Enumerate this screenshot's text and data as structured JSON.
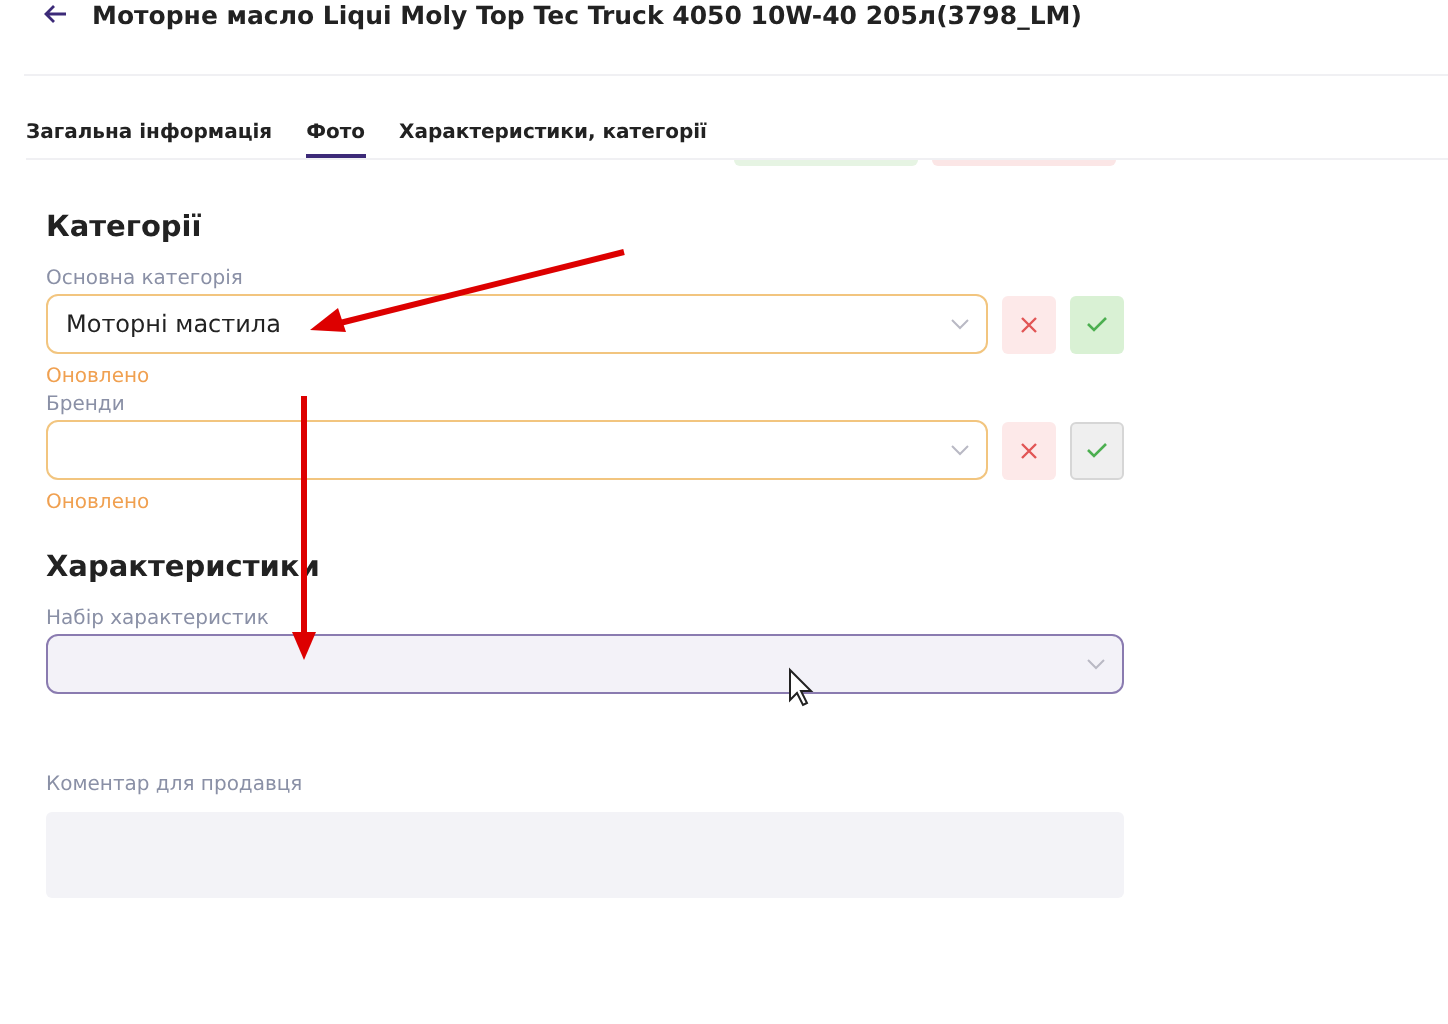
{
  "header": {
    "title": "Моторне масло Liqui Moly Top Tec Truck 4050 10W-40 205л(3798_LM)"
  },
  "tabs": [
    {
      "label": "Загальна інформація",
      "selected": false
    },
    {
      "label": "Фото",
      "selected": true
    },
    {
      "label": "Характеристики, категорії",
      "selected": false
    }
  ],
  "sections": [
    {
      "title": "Категорії",
      "fields": [
        {
          "label": "Основна категорія",
          "value": "Моторні мастила",
          "status": "Оновлено",
          "kind": "select-actions",
          "confirm_active": true
        },
        {
          "label": "Бренди",
          "status": "Оновлено",
          "kind": "select-actions",
          "confirm_active": false
        }
      ]
    },
    {
      "title": "Характеристики",
      "fields": [
        {
          "label": "Набір характеристик",
          "kind": "select-focused"
        }
      ]
    }
  ],
  "comment": {
    "label": "Коментар для продавця"
  }
}
